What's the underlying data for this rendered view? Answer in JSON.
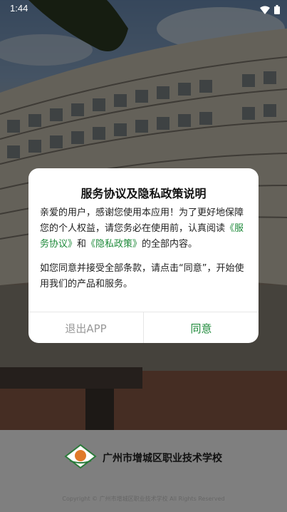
{
  "status_bar": {
    "time": "1:44",
    "icons": [
      "wifi-icon",
      "battery-icon"
    ]
  },
  "dialog": {
    "title": "服务协议及隐私政策说明",
    "para1_prefix": "亲爱的用户，感谢您使用本应用！为了更好地保障您的个人权益，请您务必在使用前，认真阅读",
    "service_link": "《服务协议》",
    "and": "和",
    "privacy_link": "《隐私政策》",
    "para1_suffix": "的全部内容。",
    "para2": "如您同意并接受全部条款，请点击“同意”，开始使用我们的产品和服务。",
    "exit_label": "退出APP",
    "agree_label": "同意"
  },
  "footer": {
    "school_name": "广州市增城区职业技术学校",
    "copyright": "Copyright © 广州市增城区职业技术学校 All Rights Reserved"
  },
  "colors": {
    "accent": "#1e8a3a",
    "overlay": "rgba(0,0,0,0.5)"
  }
}
